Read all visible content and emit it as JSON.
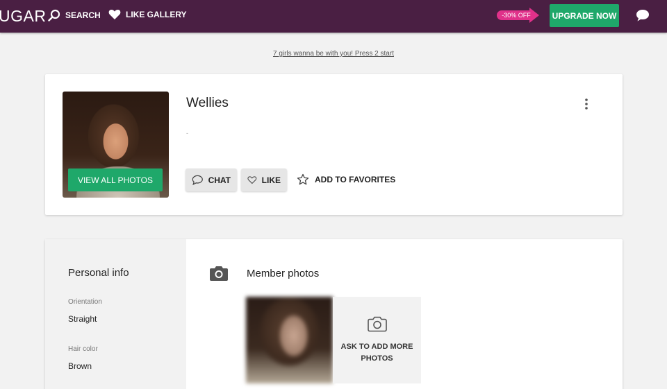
{
  "header": {
    "logo": "UGAR",
    "search_label": "SEARCH",
    "like_gallery_label": "LIKE GALLERY",
    "promo_badge": "-30% OFF",
    "upgrade_label": "UPGRADE NOW",
    "colors": {
      "bar": "#4a1f43",
      "upgrade": "#1fa86a",
      "promo": "#e0318a"
    }
  },
  "promo_link": "7 girls wanna be with you! Press 2 start",
  "profile": {
    "name": "Wellies",
    "status": "-",
    "view_photos_label": "VIEW ALL PHOTOS",
    "chat_label": "CHAT",
    "like_label": "LIKE",
    "favorites_label": "ADD TO FAVORITES"
  },
  "personal_info": {
    "title": "Personal info",
    "fields": [
      {
        "label": "Orientation",
        "value": "Straight"
      },
      {
        "label": "Hair color",
        "value": "Brown"
      }
    ]
  },
  "member_photos": {
    "title": "Member photos",
    "ask_label": "ASK TO ADD MORE PHOTOS"
  }
}
